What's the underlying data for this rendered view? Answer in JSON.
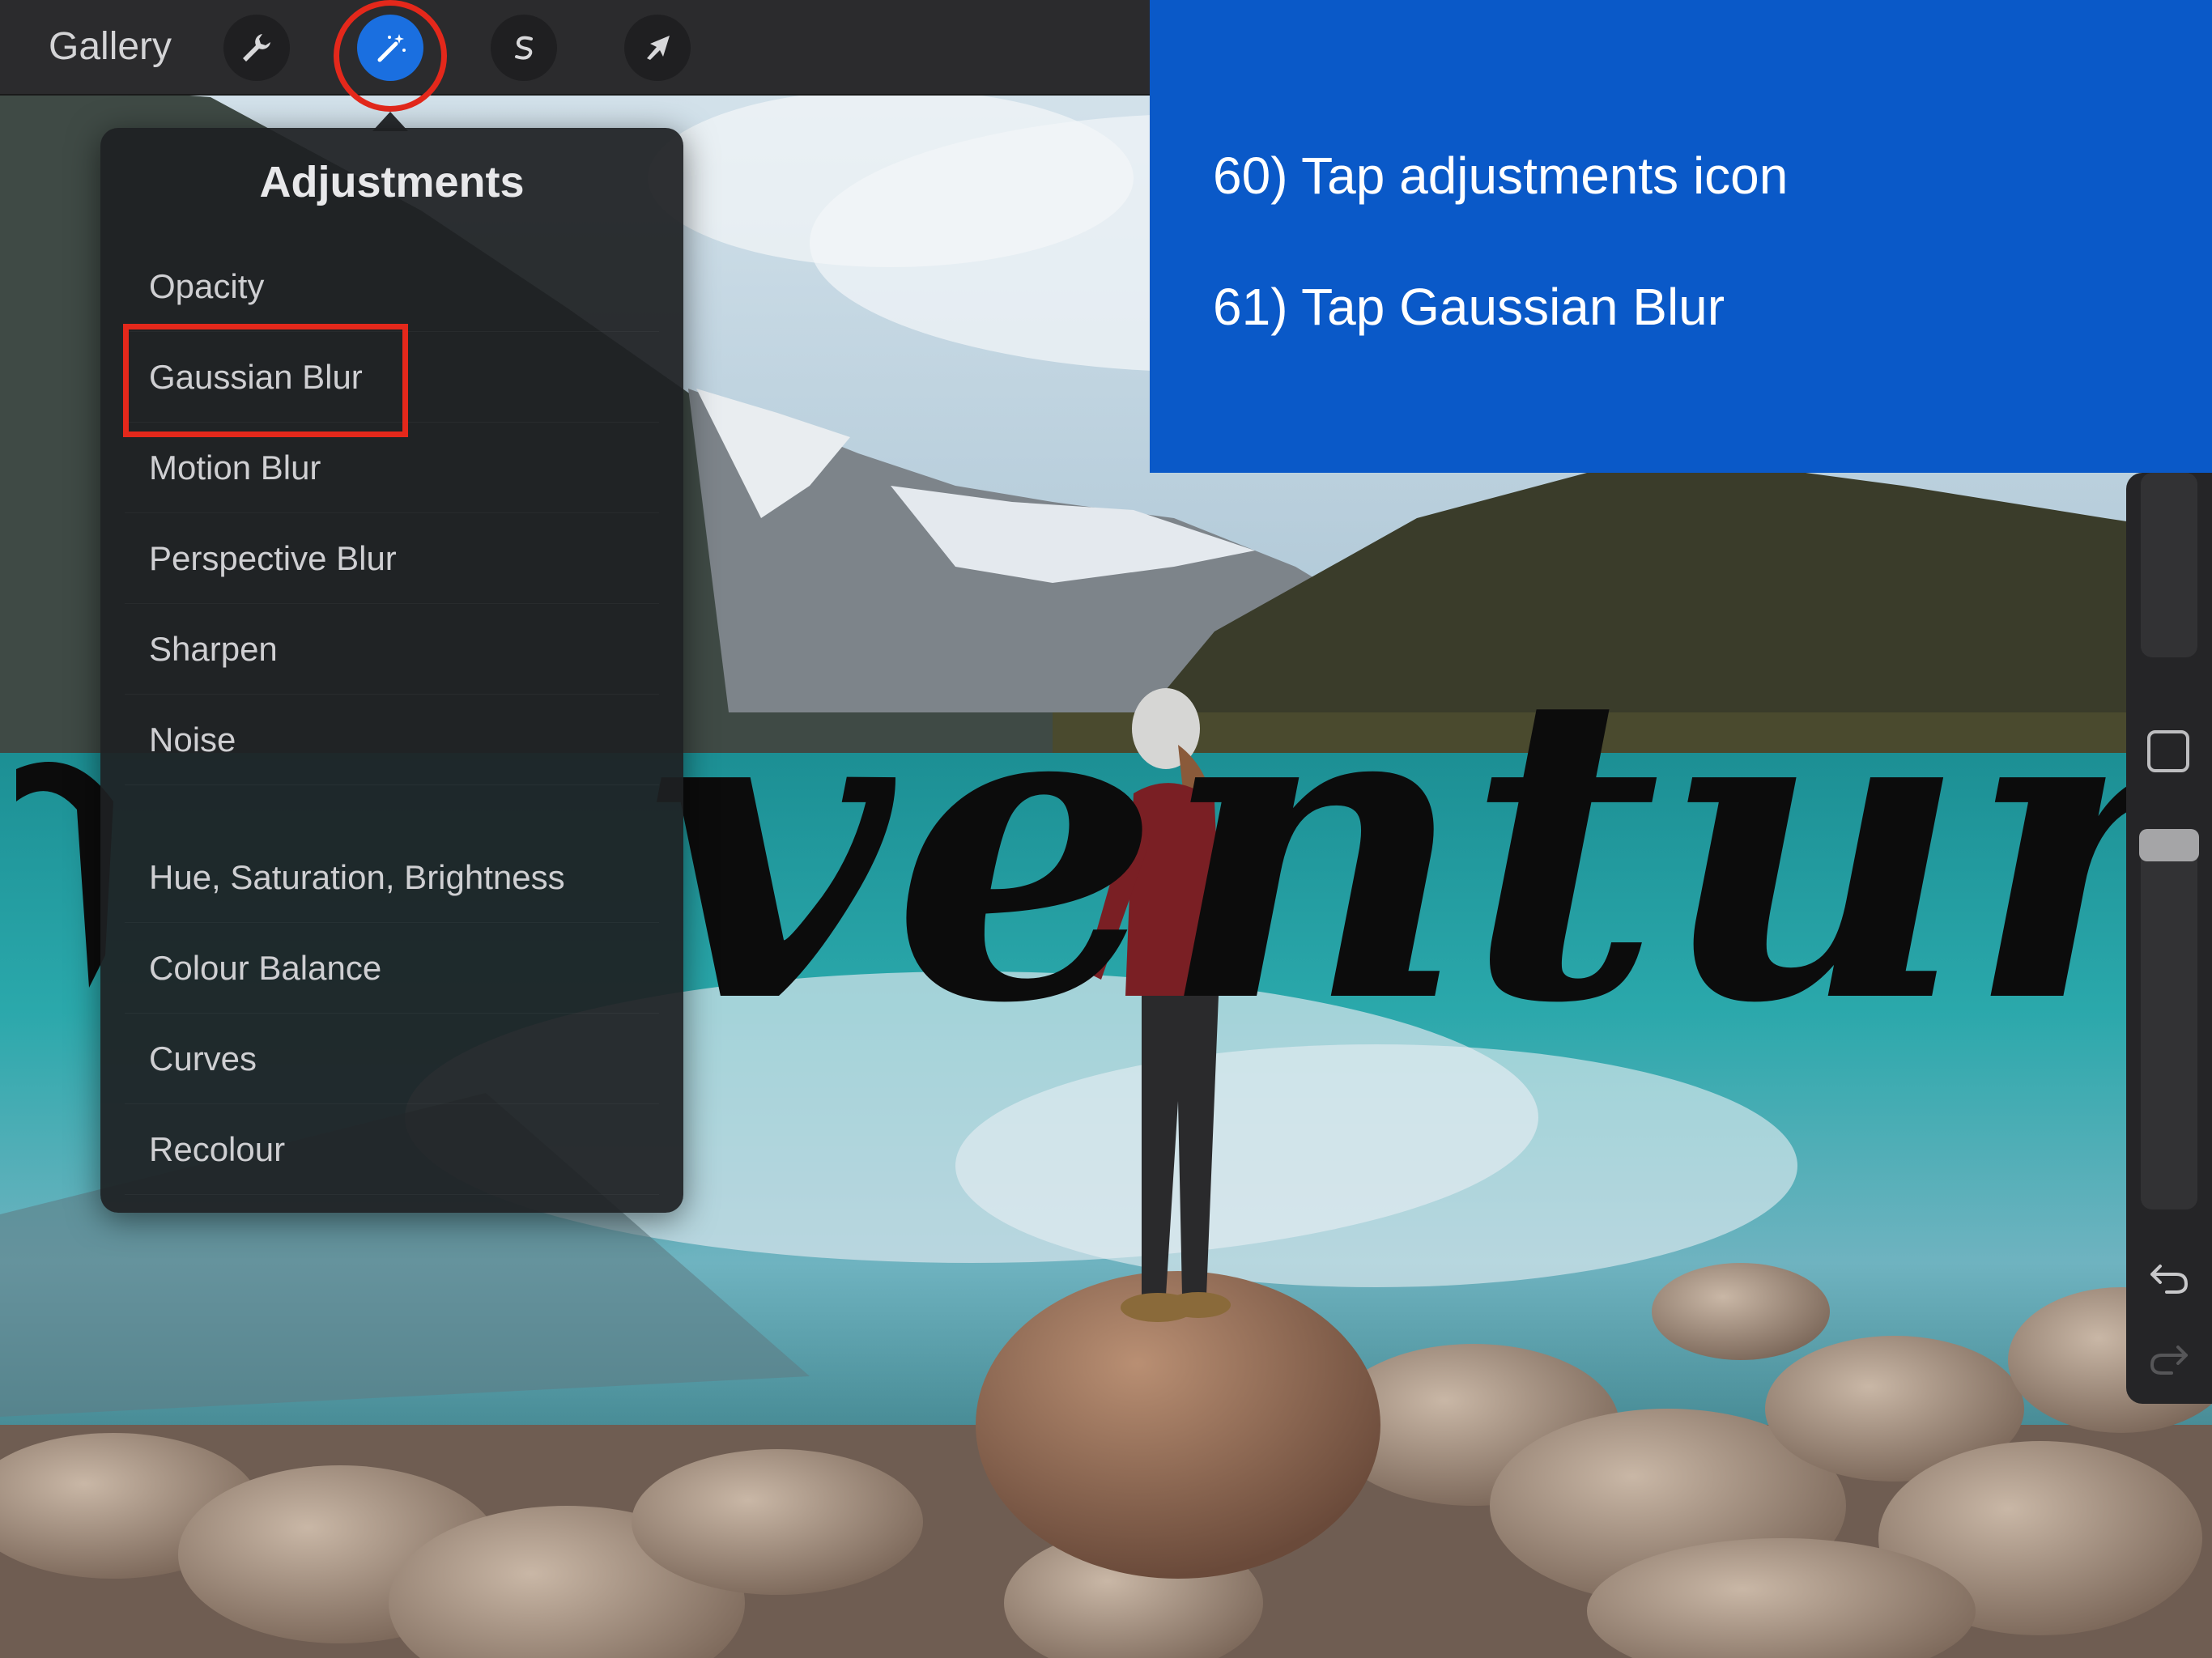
{
  "toolbar": {
    "gallery_label": "Gallery",
    "tools": [
      {
        "name": "actions",
        "icon": "wrench-icon"
      },
      {
        "name": "adjustments",
        "icon": "magic-wand-icon",
        "active": true
      },
      {
        "name": "selection",
        "icon": "selection-s-icon"
      },
      {
        "name": "transform",
        "icon": "arrow-cursor-icon"
      }
    ]
  },
  "adjustments_menu": {
    "title": "Adjustments",
    "items": [
      "Opacity",
      "Gaussian Blur",
      "Motion Blur",
      "Perspective Blur",
      "Sharpen",
      "Noise",
      "Hue, Saturation, Brightness",
      "Colour Balance",
      "Curves",
      "Recolour"
    ],
    "highlighted_item": "Gaussian Blur"
  },
  "instructions": {
    "step_60": "60) Tap adjustments icon",
    "step_61": "61) Tap Gaussian Blur"
  },
  "canvas": {
    "lettering_text": "venture"
  },
  "sidebar": {
    "icons": [
      "brush-size-slider",
      "modify-square-icon",
      "opacity-slider",
      "undo-icon",
      "redo-icon"
    ]
  },
  "colors": {
    "accent_blue": "#1a6fe0",
    "instruction_bg": "#0a59c8",
    "highlight_red": "#e4281b",
    "lake_teal": "#1e9aa0"
  }
}
